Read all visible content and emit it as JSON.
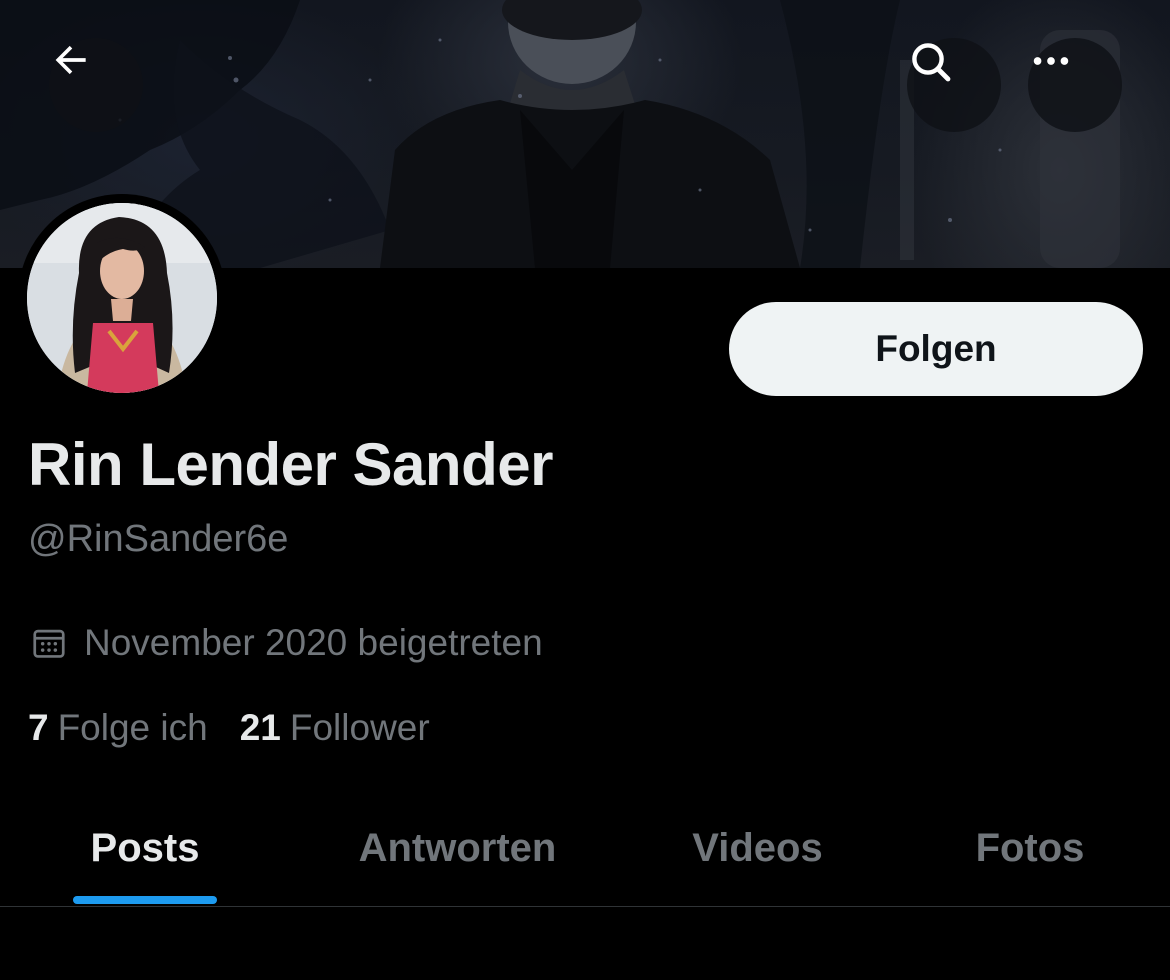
{
  "header": {
    "back_icon": "arrow-left-icon",
    "search_icon": "search-icon",
    "more_icon": "more-horizontal-icon"
  },
  "profile": {
    "name": "Rin Lender Sander",
    "handle": "@RinSander6e",
    "joined": "November 2020 beigetreten",
    "joined_icon": "calendar-icon",
    "follow_label": "Folgen",
    "following_count": "7",
    "following_label": "Folge ich",
    "followers_count": "21",
    "followers_label": "Follower"
  },
  "tabs": [
    {
      "label": "Posts",
      "active": true
    },
    {
      "label": "Antworten",
      "active": false
    },
    {
      "label": "Videos",
      "active": false
    },
    {
      "label": "Fotos",
      "active": false
    }
  ],
  "colors": {
    "background": "#000000",
    "text_primary": "#e7e9ea",
    "text_secondary": "#71767b",
    "accent": "#1d9bf0",
    "follow_button_bg": "#eff3f4"
  }
}
